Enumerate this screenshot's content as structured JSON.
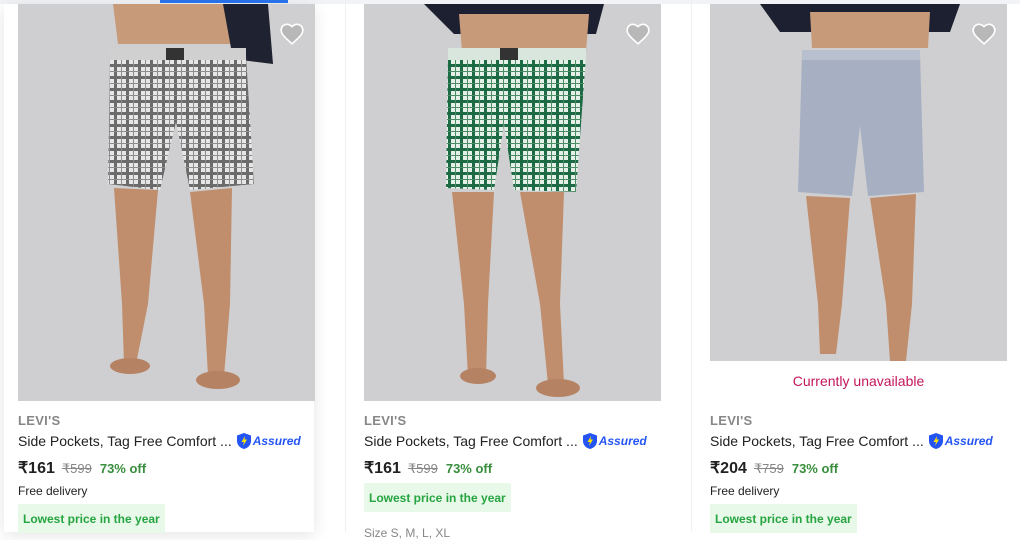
{
  "theme": {
    "accent": "#2874f0",
    "discount_green": "#388e3c",
    "badge_green": "#26a541",
    "badge_bg": "#e8f8e9",
    "unavailable": "#c2185b",
    "assured_blue": "#2455f4"
  },
  "products": [
    {
      "brand": "LEVI'S",
      "title": "Side Pockets, Tag Free Comfort ...",
      "assured_label": "Assured",
      "price": "₹161",
      "mrp": "₹599",
      "discount": "73% off",
      "delivery": "Free delivery",
      "badge": "Lowest price in the year",
      "image": {
        "description": "green-check-boxer",
        "short_color": "#d8d8d8",
        "check_color": "#5a5a5a"
      },
      "wishlist_icon": "heart-icon"
    },
    {
      "brand": "LEVI'S",
      "title": "Side Pockets, Tag Free Comfort ...",
      "assured_label": "Assured",
      "price": "₹161",
      "mrp": "₹599",
      "discount": "73% off",
      "badge": "Lowest price in the year",
      "sizes": "Size S, M, L, XL",
      "image": {
        "description": "green-check-boxer",
        "short_color": "#cfe3d6",
        "check_color": "#1d6b44"
      },
      "wishlist_icon": "heart-icon"
    },
    {
      "brand": "LEVI'S",
      "title": "Side Pockets, Tag Free Comfort ...",
      "assured_label": "Assured",
      "price": "₹204",
      "mrp": "₹759",
      "discount": "73% off",
      "delivery": "Free delivery",
      "badge": "Lowest price in the year",
      "status": "Currently unavailable",
      "image": {
        "description": "light-blue-boxer",
        "short_color": "#a7b0c3",
        "check_color": "#a7b0c3"
      },
      "wishlist_icon": "heart-icon"
    }
  ]
}
